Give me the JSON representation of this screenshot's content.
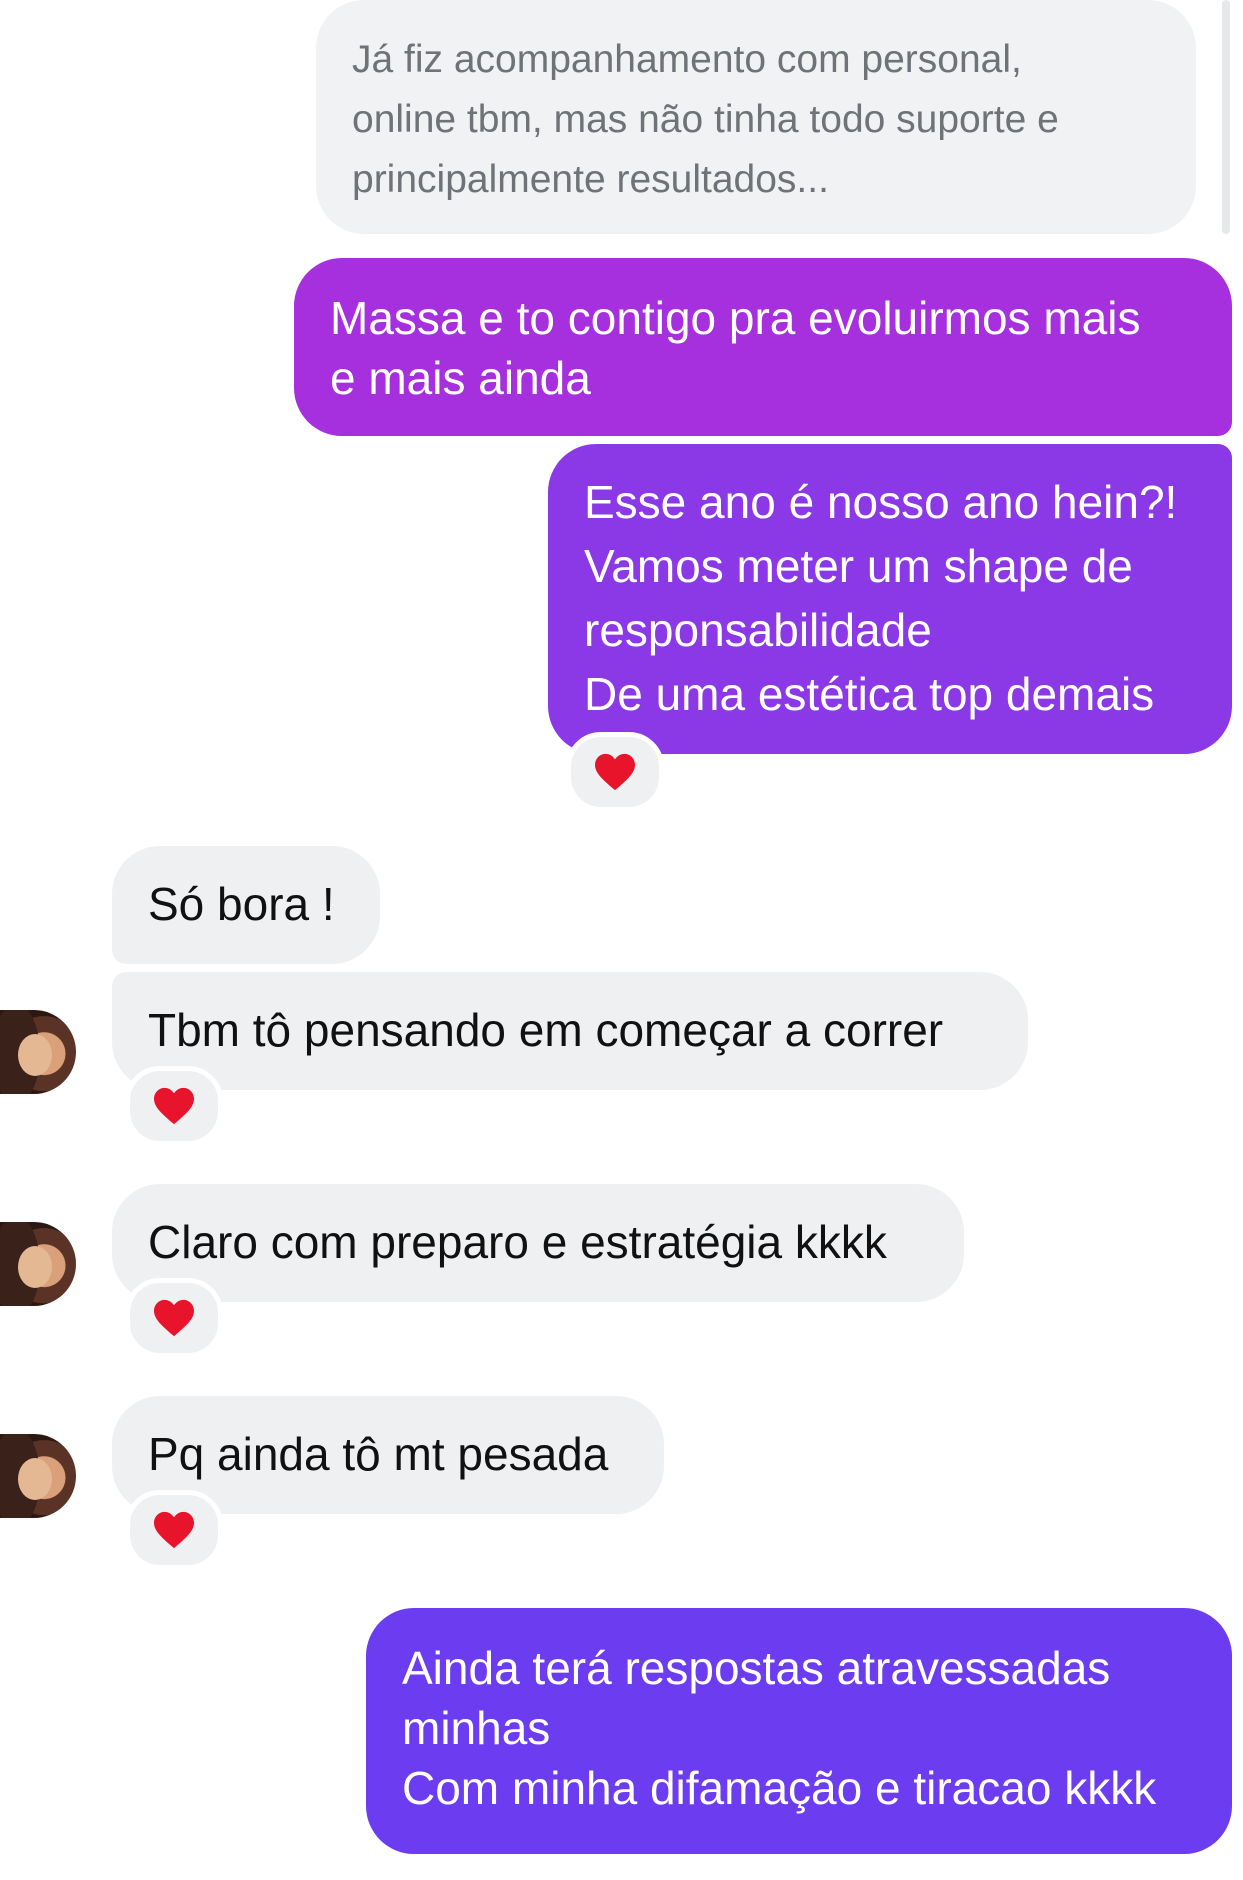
{
  "conversation": {
    "quoted_message": {
      "lines": [
        "Já fiz acompanhamento com personal,",
        "online tbm, mas não tinha todo suporte e",
        "principalmente resultados..."
      ]
    },
    "messages": [
      {
        "direction": "sent",
        "lines": [
          "Massa e to contigo pra evoluirmos mais",
          "e mais ainda"
        ]
      },
      {
        "direction": "sent",
        "lines": [
          "Esse ano é nosso ano hein?!",
          "Vamos meter um shape de",
          "responsabilidade",
          "De uma estética  top demais"
        ],
        "reaction": "red-heart"
      },
      {
        "direction": "received",
        "lines": [
          "Só bora !"
        ]
      },
      {
        "direction": "received",
        "lines": [
          "Tbm tô pensando em começar a correr"
        ],
        "reaction": "red-heart"
      },
      {
        "direction": "received",
        "lines": [
          "Claro com preparo e estratégia kkkk"
        ],
        "reaction": "red-heart"
      },
      {
        "direction": "received",
        "lines": [
          "Pq ainda tô mt pesada"
        ],
        "reaction": "red-heart"
      },
      {
        "direction": "sent",
        "lines": [
          "Ainda terá respostas atravessadas",
          "minhas",
          "Com minha difamação e tiracao kkkk"
        ]
      }
    ]
  },
  "colors": {
    "sent_bubble_1": "#a730de",
    "sent_bubble_2": "#8b38e6",
    "sent_bubble_3": "#6c3df0",
    "received_bubble": "#eff0f2",
    "reaction_heart": "#e8142b"
  }
}
